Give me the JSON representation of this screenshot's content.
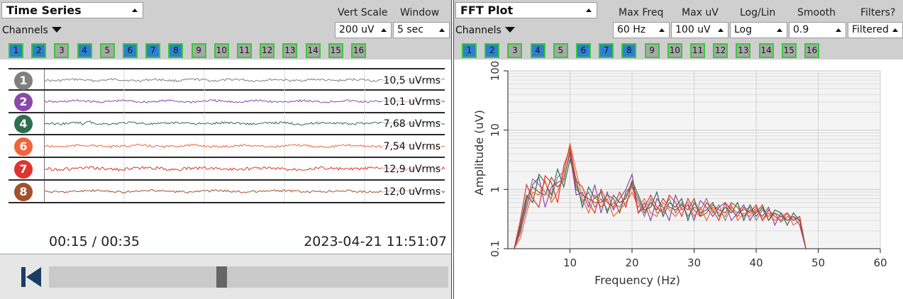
{
  "colors": {
    "channel_on": "#2e7fd1",
    "channel_off": "#a8a8a8",
    "channel_border": "#33cc33",
    "header_bg": "#cfcfcf",
    "ch1": "#808080",
    "ch2": "#8b48a8",
    "ch4": "#2f6e50",
    "ch6": "#f2643a",
    "ch7": "#e0332e",
    "ch8": "#a2502e"
  },
  "time_series": {
    "title": "Time Series",
    "vert_scale_label": "Vert Scale",
    "window_label": "Window",
    "channels_label": "Channels",
    "vert_scale_value": "200 uV",
    "window_value": "5 sec",
    "channel_buttons": [
      {
        "label": "1",
        "on": true
      },
      {
        "label": "2",
        "on": true
      },
      {
        "label": "3",
        "on": false
      },
      {
        "label": "4",
        "on": true
      },
      {
        "label": "5",
        "on": false
      },
      {
        "label": "6",
        "on": true
      },
      {
        "label": "7",
        "on": true
      },
      {
        "label": "8",
        "on": true
      },
      {
        "label": "9",
        "on": false
      },
      {
        "label": "10",
        "on": false
      },
      {
        "label": "11",
        "on": false
      },
      {
        "label": "12",
        "on": false
      },
      {
        "label": "13",
        "on": false
      },
      {
        "label": "14",
        "on": false
      },
      {
        "label": "15",
        "on": false
      },
      {
        "label": "16",
        "on": false
      }
    ],
    "traces": [
      {
        "channel": "1",
        "rms": "10,5 uVrms",
        "color": "#808080"
      },
      {
        "channel": "2",
        "rms": "10,1 uVrms",
        "color": "#8b48a8"
      },
      {
        "channel": "4",
        "rms": "7,68 uVrms",
        "color": "#2f6e50"
      },
      {
        "channel": "6",
        "rms": "7,54 uVrms",
        "color": "#f2643a"
      },
      {
        "channel": "7",
        "rms": "12,9 uVrms",
        "color": "#e0332e"
      },
      {
        "channel": "8",
        "rms": "12,0 uVrms",
        "color": "#a2502e"
      }
    ],
    "playback_time": "00:15 / 00:35",
    "timestamp": "2023-04-21 11:51:07",
    "playback_progress": 0.43
  },
  "fft": {
    "title": "FFT Plot",
    "max_freq_label": "Max Freq",
    "max_uv_label": "Max uV",
    "loglin_label": "Log/Lin",
    "smooth_label": "Smooth",
    "filters_label": "Filters?",
    "channels_label": "Channels",
    "max_freq_value": "60 Hz",
    "max_uv_value": "100 uV",
    "loglin_value": "Log",
    "smooth_value": "0.9",
    "filters_value": "Filtered",
    "channel_buttons": [
      {
        "label": "1",
        "on": true
      },
      {
        "label": "2",
        "on": true
      },
      {
        "label": "3",
        "on": false
      },
      {
        "label": "4",
        "on": true
      },
      {
        "label": "5",
        "on": false
      },
      {
        "label": "6",
        "on": true
      },
      {
        "label": "7",
        "on": true
      },
      {
        "label": "8",
        "on": true
      },
      {
        "label": "9",
        "on": false
      },
      {
        "label": "10",
        "on": false
      },
      {
        "label": "11",
        "on": false
      },
      {
        "label": "12",
        "on": false
      },
      {
        "label": "13",
        "on": false
      },
      {
        "label": "14",
        "on": false
      },
      {
        "label": "15",
        "on": false
      },
      {
        "label": "16",
        "on": false
      }
    ]
  },
  "chart_data": {
    "type": "line",
    "title": "",
    "xlabel": "Frequency (Hz)",
    "ylabel": "Amplitude (uV)",
    "x_ticks": [
      "10",
      "20",
      "30",
      "40",
      "50",
      "60"
    ],
    "y_ticks": [
      "0.1",
      "1",
      "10",
      "100"
    ],
    "xlim": [
      0,
      60
    ],
    "ylim": [
      0.1,
      100
    ],
    "y_scale": "log",
    "grid": true,
    "x": [
      1,
      2,
      3,
      4,
      5,
      6,
      7,
      8,
      9,
      10,
      11,
      12,
      13,
      14,
      15,
      16,
      17,
      18,
      19,
      20,
      21,
      22,
      23,
      24,
      25,
      26,
      27,
      28,
      29,
      30,
      31,
      32,
      33,
      34,
      35,
      36,
      37,
      38,
      39,
      40,
      41,
      42,
      43,
      44,
      45,
      46,
      47,
      48
    ],
    "series": [
      {
        "color": "#808080",
        "values": [
          0.1,
          0.18,
          0.6,
          1.5,
          1.2,
          0.9,
          0.7,
          1.6,
          2.0,
          5.5,
          1.2,
          0.6,
          0.9,
          0.5,
          0.7,
          0.45,
          0.6,
          0.5,
          0.8,
          1.1,
          0.6,
          0.35,
          0.7,
          0.4,
          0.45,
          0.7,
          0.4,
          0.6,
          0.35,
          0.5,
          0.45,
          0.7,
          0.4,
          0.55,
          0.3,
          0.5,
          0.4,
          0.45,
          0.5,
          0.3,
          0.45,
          0.35,
          0.4,
          0.28,
          0.35,
          0.3,
          0.35,
          0.1
        ]
      },
      {
        "color": "#8b48a8",
        "values": [
          0.1,
          0.2,
          0.5,
          1.2,
          1.6,
          0.5,
          1.1,
          1.3,
          1.5,
          4.0,
          0.8,
          0.9,
          0.5,
          1.2,
          0.4,
          0.9,
          0.45,
          0.7,
          1.0,
          1.8,
          0.4,
          0.6,
          0.3,
          0.7,
          0.5,
          0.3,
          0.8,
          0.45,
          0.55,
          0.3,
          0.65,
          0.5,
          0.35,
          0.5,
          0.6,
          0.3,
          0.4,
          0.55,
          0.3,
          0.45,
          0.35,
          0.5,
          0.25,
          0.4,
          0.3,
          0.35,
          0.25,
          0.1
        ]
      },
      {
        "color": "#2f6e50",
        "values": [
          0.1,
          0.25,
          0.8,
          0.6,
          1.8,
          1.3,
          0.8,
          2.2,
          1.1,
          3.2,
          1.5,
          0.5,
          1.1,
          0.7,
          0.9,
          0.4,
          0.8,
          0.6,
          0.7,
          1.4,
          0.8,
          0.45,
          0.5,
          0.9,
          0.35,
          0.6,
          0.5,
          0.7,
          0.3,
          0.6,
          0.4,
          0.45,
          0.6,
          0.35,
          0.5,
          0.4,
          0.6,
          0.3,
          0.55,
          0.35,
          0.5,
          0.3,
          0.45,
          0.4,
          0.25,
          0.4,
          0.3,
          0.1
        ]
      },
      {
        "color": "#f2643a",
        "values": [
          0.1,
          0.15,
          0.4,
          0.9,
          0.8,
          1.4,
          0.6,
          0.9,
          1.8,
          6.0,
          2.0,
          0.7,
          0.4,
          0.8,
          0.5,
          0.7,
          0.35,
          0.45,
          0.6,
          0.9,
          0.5,
          0.7,
          0.4,
          0.35,
          0.6,
          0.45,
          0.35,
          0.5,
          0.6,
          0.35,
          0.5,
          0.3,
          0.5,
          0.4,
          0.35,
          0.55,
          0.3,
          0.4,
          0.35,
          0.5,
          0.3,
          0.4,
          0.3,
          0.35,
          0.4,
          0.25,
          0.3,
          0.1
        ]
      },
      {
        "color": "#e0332e",
        "values": [
          0.1,
          0.3,
          1.2,
          0.7,
          0.5,
          1.7,
          1.3,
          0.6,
          2.5,
          5.0,
          1.4,
          1.1,
          0.6,
          0.4,
          1.0,
          0.6,
          0.5,
          0.9,
          0.5,
          1.3,
          0.4,
          0.5,
          0.8,
          0.5,
          0.4,
          0.8,
          0.6,
          0.35,
          0.7,
          0.45,
          0.35,
          0.6,
          0.45,
          0.3,
          0.6,
          0.45,
          0.35,
          0.5,
          0.4,
          0.55,
          0.3,
          0.45,
          0.35,
          0.3,
          0.4,
          0.3,
          0.35,
          0.1
        ]
      },
      {
        "color": "#a2502e",
        "values": [
          0.1,
          0.22,
          0.7,
          1.1,
          0.9,
          0.8,
          1.6,
          1.1,
          1.4,
          4.5,
          1.0,
          0.8,
          0.7,
          0.6,
          0.6,
          0.8,
          0.7,
          0.4,
          0.9,
          1.2,
          0.7,
          0.4,
          0.6,
          0.45,
          0.7,
          0.5,
          0.45,
          0.55,
          0.45,
          0.7,
          0.35,
          0.4,
          0.55,
          0.45,
          0.4,
          0.6,
          0.5,
          0.35,
          0.45,
          0.4,
          0.55,
          0.3,
          0.4,
          0.35,
          0.3,
          0.35,
          0.3,
          0.1
        ]
      }
    ]
  }
}
